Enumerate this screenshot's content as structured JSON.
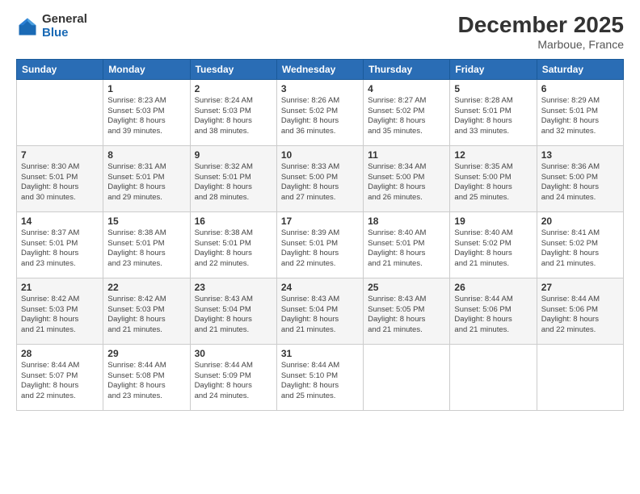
{
  "logo": {
    "general": "General",
    "blue": "Blue"
  },
  "title": "December 2025",
  "location": "Marboue, France",
  "days_of_week": [
    "Sunday",
    "Monday",
    "Tuesday",
    "Wednesday",
    "Thursday",
    "Friday",
    "Saturday"
  ],
  "weeks": [
    [
      {
        "day": "",
        "info": ""
      },
      {
        "day": "1",
        "info": "Sunrise: 8:23 AM\nSunset: 5:03 PM\nDaylight: 8 hours\nand 39 minutes."
      },
      {
        "day": "2",
        "info": "Sunrise: 8:24 AM\nSunset: 5:03 PM\nDaylight: 8 hours\nand 38 minutes."
      },
      {
        "day": "3",
        "info": "Sunrise: 8:26 AM\nSunset: 5:02 PM\nDaylight: 8 hours\nand 36 minutes."
      },
      {
        "day": "4",
        "info": "Sunrise: 8:27 AM\nSunset: 5:02 PM\nDaylight: 8 hours\nand 35 minutes."
      },
      {
        "day": "5",
        "info": "Sunrise: 8:28 AM\nSunset: 5:01 PM\nDaylight: 8 hours\nand 33 minutes."
      },
      {
        "day": "6",
        "info": "Sunrise: 8:29 AM\nSunset: 5:01 PM\nDaylight: 8 hours\nand 32 minutes."
      }
    ],
    [
      {
        "day": "7",
        "info": "Sunrise: 8:30 AM\nSunset: 5:01 PM\nDaylight: 8 hours\nand 30 minutes."
      },
      {
        "day": "8",
        "info": "Sunrise: 8:31 AM\nSunset: 5:01 PM\nDaylight: 8 hours\nand 29 minutes."
      },
      {
        "day": "9",
        "info": "Sunrise: 8:32 AM\nSunset: 5:01 PM\nDaylight: 8 hours\nand 28 minutes."
      },
      {
        "day": "10",
        "info": "Sunrise: 8:33 AM\nSunset: 5:00 PM\nDaylight: 8 hours\nand 27 minutes."
      },
      {
        "day": "11",
        "info": "Sunrise: 8:34 AM\nSunset: 5:00 PM\nDaylight: 8 hours\nand 26 minutes."
      },
      {
        "day": "12",
        "info": "Sunrise: 8:35 AM\nSunset: 5:00 PM\nDaylight: 8 hours\nand 25 minutes."
      },
      {
        "day": "13",
        "info": "Sunrise: 8:36 AM\nSunset: 5:00 PM\nDaylight: 8 hours\nand 24 minutes."
      }
    ],
    [
      {
        "day": "14",
        "info": "Sunrise: 8:37 AM\nSunset: 5:01 PM\nDaylight: 8 hours\nand 23 minutes."
      },
      {
        "day": "15",
        "info": "Sunrise: 8:38 AM\nSunset: 5:01 PM\nDaylight: 8 hours\nand 23 minutes."
      },
      {
        "day": "16",
        "info": "Sunrise: 8:38 AM\nSunset: 5:01 PM\nDaylight: 8 hours\nand 22 minutes."
      },
      {
        "day": "17",
        "info": "Sunrise: 8:39 AM\nSunset: 5:01 PM\nDaylight: 8 hours\nand 22 minutes."
      },
      {
        "day": "18",
        "info": "Sunrise: 8:40 AM\nSunset: 5:01 PM\nDaylight: 8 hours\nand 21 minutes."
      },
      {
        "day": "19",
        "info": "Sunrise: 8:40 AM\nSunset: 5:02 PM\nDaylight: 8 hours\nand 21 minutes."
      },
      {
        "day": "20",
        "info": "Sunrise: 8:41 AM\nSunset: 5:02 PM\nDaylight: 8 hours\nand 21 minutes."
      }
    ],
    [
      {
        "day": "21",
        "info": "Sunrise: 8:42 AM\nSunset: 5:03 PM\nDaylight: 8 hours\nand 21 minutes."
      },
      {
        "day": "22",
        "info": "Sunrise: 8:42 AM\nSunset: 5:03 PM\nDaylight: 8 hours\nand 21 minutes."
      },
      {
        "day": "23",
        "info": "Sunrise: 8:43 AM\nSunset: 5:04 PM\nDaylight: 8 hours\nand 21 minutes."
      },
      {
        "day": "24",
        "info": "Sunrise: 8:43 AM\nSunset: 5:04 PM\nDaylight: 8 hours\nand 21 minutes."
      },
      {
        "day": "25",
        "info": "Sunrise: 8:43 AM\nSunset: 5:05 PM\nDaylight: 8 hours\nand 21 minutes."
      },
      {
        "day": "26",
        "info": "Sunrise: 8:44 AM\nSunset: 5:06 PM\nDaylight: 8 hours\nand 21 minutes."
      },
      {
        "day": "27",
        "info": "Sunrise: 8:44 AM\nSunset: 5:06 PM\nDaylight: 8 hours\nand 22 minutes."
      }
    ],
    [
      {
        "day": "28",
        "info": "Sunrise: 8:44 AM\nSunset: 5:07 PM\nDaylight: 8 hours\nand 22 minutes."
      },
      {
        "day": "29",
        "info": "Sunrise: 8:44 AM\nSunset: 5:08 PM\nDaylight: 8 hours\nand 23 minutes."
      },
      {
        "day": "30",
        "info": "Sunrise: 8:44 AM\nSunset: 5:09 PM\nDaylight: 8 hours\nand 24 minutes."
      },
      {
        "day": "31",
        "info": "Sunrise: 8:44 AM\nSunset: 5:10 PM\nDaylight: 8 hours\nand 25 minutes."
      },
      {
        "day": "",
        "info": ""
      },
      {
        "day": "",
        "info": ""
      },
      {
        "day": "",
        "info": ""
      }
    ]
  ]
}
